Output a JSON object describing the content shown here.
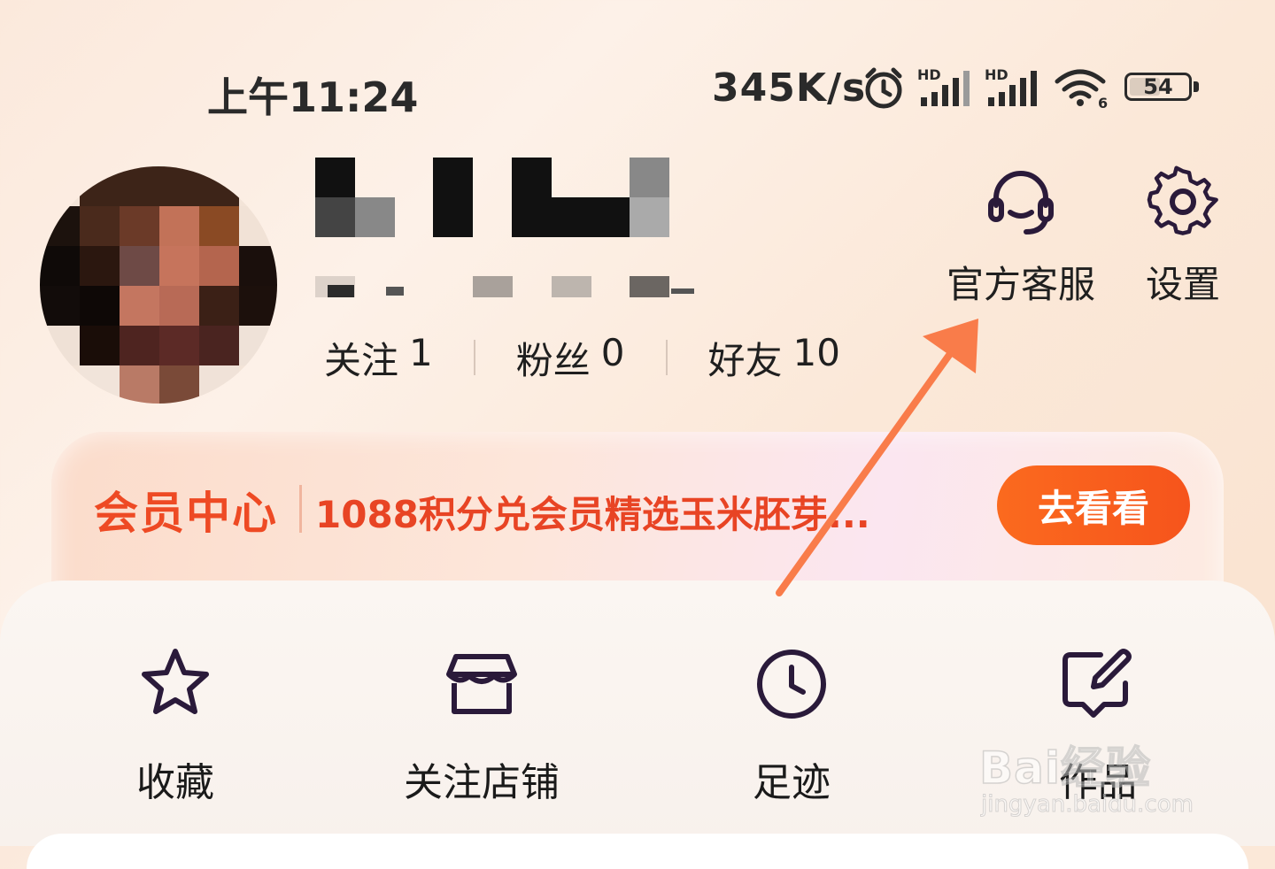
{
  "status_bar": {
    "time": "上午11:24",
    "net_speed": "345K/s",
    "signal1_label": "HD",
    "signal2_label": "HD",
    "wifi_label": "6",
    "battery": "54",
    "icons": [
      "alarm-icon",
      "signal-icon",
      "signal-icon",
      "wifi-icon",
      "battery-icon"
    ]
  },
  "profile": {
    "counts": [
      {
        "label": "关注",
        "value": "1"
      },
      {
        "label": "粉丝",
        "value": "0"
      },
      {
        "label": "好友",
        "value": "10"
      }
    ]
  },
  "top_actions": [
    {
      "label": "官方客服",
      "icon": "headset-icon"
    },
    {
      "label": "设置",
      "icon": "gear-icon"
    }
  ],
  "vip": {
    "title": "会员中心",
    "promo": "1088积分兑会员精选玉米胚芽...",
    "button": "去看看"
  },
  "menu": [
    {
      "label": "收藏",
      "icon": "star-icon"
    },
    {
      "label": "关注店铺",
      "icon": "store-icon"
    },
    {
      "label": "足迹",
      "icon": "clock-icon"
    },
    {
      "label": "作品",
      "icon": "edit-icon"
    }
  ],
  "watermark": {
    "main": "Bai经验",
    "sub": "jingyan.baidu.com"
  },
  "colors": {
    "accent": "#ee4a24",
    "button": "#f6541c",
    "arrow": "#f97c4a",
    "icon_stroke": "#2a1a3a"
  }
}
